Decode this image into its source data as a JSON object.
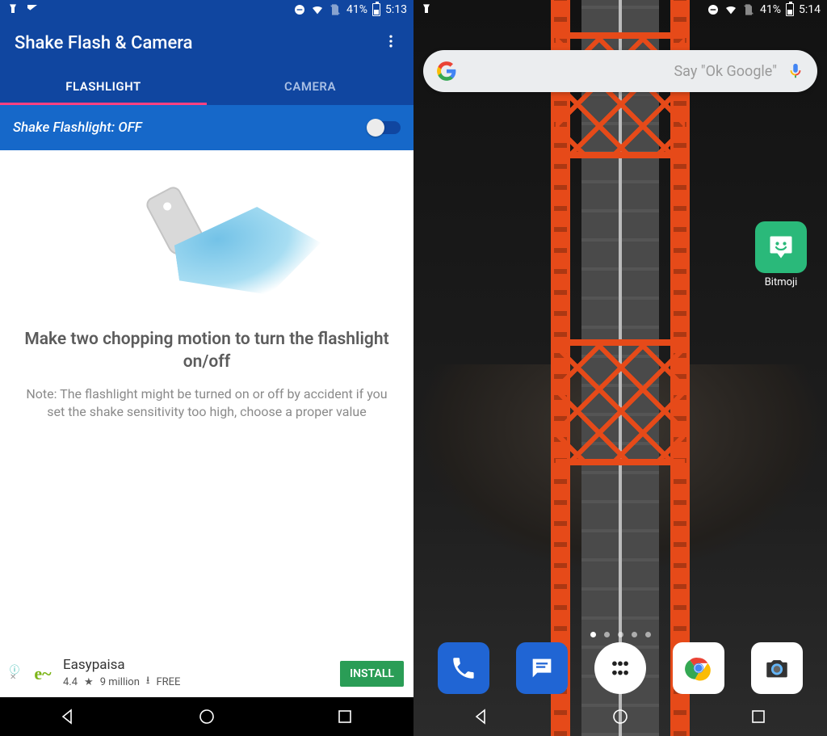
{
  "left": {
    "status": {
      "battery": "41%",
      "time": "5:13"
    },
    "appbar": {
      "title": "Shake Flash & Camera"
    },
    "tabs": {
      "flashlight": "FLASHLIGHT",
      "camera": "CAMERA"
    },
    "toggle": {
      "label": "Shake Flashlight: OFF"
    },
    "hero": {
      "headline": "Make two chopping motion to turn the flashlight on/off",
      "note": "Note: The flashlight might be turned on or off by accident if you set the shake sensitivity too high, choose a proper value"
    },
    "ad": {
      "name": "Easypaisa",
      "rating": "4.4",
      "downloads": "9 million",
      "price": "FREE",
      "cta": "INSTALL"
    }
  },
  "right": {
    "status": {
      "battery": "41%",
      "time": "5:14"
    },
    "search": {
      "hint": "Say \"Ok Google\""
    },
    "apps": {
      "bitmoji": "Bitmoji"
    }
  }
}
